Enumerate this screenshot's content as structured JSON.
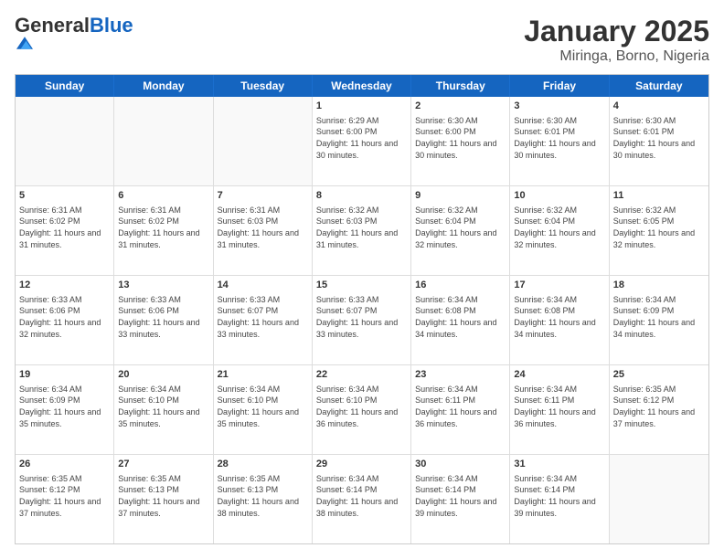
{
  "logo": {
    "general": "General",
    "blue": "Blue"
  },
  "title": "January 2025",
  "subtitle": "Miringa, Borno, Nigeria",
  "days": [
    "Sunday",
    "Monday",
    "Tuesday",
    "Wednesday",
    "Thursday",
    "Friday",
    "Saturday"
  ],
  "weeks": [
    [
      {
        "day": "",
        "info": ""
      },
      {
        "day": "",
        "info": ""
      },
      {
        "day": "",
        "info": ""
      },
      {
        "day": "1",
        "info": "Sunrise: 6:29 AM\nSunset: 6:00 PM\nDaylight: 11 hours and 30 minutes."
      },
      {
        "day": "2",
        "info": "Sunrise: 6:30 AM\nSunset: 6:00 PM\nDaylight: 11 hours and 30 minutes."
      },
      {
        "day": "3",
        "info": "Sunrise: 6:30 AM\nSunset: 6:01 PM\nDaylight: 11 hours and 30 minutes."
      },
      {
        "day": "4",
        "info": "Sunrise: 6:30 AM\nSunset: 6:01 PM\nDaylight: 11 hours and 30 minutes."
      }
    ],
    [
      {
        "day": "5",
        "info": "Sunrise: 6:31 AM\nSunset: 6:02 PM\nDaylight: 11 hours and 31 minutes."
      },
      {
        "day": "6",
        "info": "Sunrise: 6:31 AM\nSunset: 6:02 PM\nDaylight: 11 hours and 31 minutes."
      },
      {
        "day": "7",
        "info": "Sunrise: 6:31 AM\nSunset: 6:03 PM\nDaylight: 11 hours and 31 minutes."
      },
      {
        "day": "8",
        "info": "Sunrise: 6:32 AM\nSunset: 6:03 PM\nDaylight: 11 hours and 31 minutes."
      },
      {
        "day": "9",
        "info": "Sunrise: 6:32 AM\nSunset: 6:04 PM\nDaylight: 11 hours and 32 minutes."
      },
      {
        "day": "10",
        "info": "Sunrise: 6:32 AM\nSunset: 6:04 PM\nDaylight: 11 hours and 32 minutes."
      },
      {
        "day": "11",
        "info": "Sunrise: 6:32 AM\nSunset: 6:05 PM\nDaylight: 11 hours and 32 minutes."
      }
    ],
    [
      {
        "day": "12",
        "info": "Sunrise: 6:33 AM\nSunset: 6:06 PM\nDaylight: 11 hours and 32 minutes."
      },
      {
        "day": "13",
        "info": "Sunrise: 6:33 AM\nSunset: 6:06 PM\nDaylight: 11 hours and 33 minutes."
      },
      {
        "day": "14",
        "info": "Sunrise: 6:33 AM\nSunset: 6:07 PM\nDaylight: 11 hours and 33 minutes."
      },
      {
        "day": "15",
        "info": "Sunrise: 6:33 AM\nSunset: 6:07 PM\nDaylight: 11 hours and 33 minutes."
      },
      {
        "day": "16",
        "info": "Sunrise: 6:34 AM\nSunset: 6:08 PM\nDaylight: 11 hours and 34 minutes."
      },
      {
        "day": "17",
        "info": "Sunrise: 6:34 AM\nSunset: 6:08 PM\nDaylight: 11 hours and 34 minutes."
      },
      {
        "day": "18",
        "info": "Sunrise: 6:34 AM\nSunset: 6:09 PM\nDaylight: 11 hours and 34 minutes."
      }
    ],
    [
      {
        "day": "19",
        "info": "Sunrise: 6:34 AM\nSunset: 6:09 PM\nDaylight: 11 hours and 35 minutes."
      },
      {
        "day": "20",
        "info": "Sunrise: 6:34 AM\nSunset: 6:10 PM\nDaylight: 11 hours and 35 minutes."
      },
      {
        "day": "21",
        "info": "Sunrise: 6:34 AM\nSunset: 6:10 PM\nDaylight: 11 hours and 35 minutes."
      },
      {
        "day": "22",
        "info": "Sunrise: 6:34 AM\nSunset: 6:10 PM\nDaylight: 11 hours and 36 minutes."
      },
      {
        "day": "23",
        "info": "Sunrise: 6:34 AM\nSunset: 6:11 PM\nDaylight: 11 hours and 36 minutes."
      },
      {
        "day": "24",
        "info": "Sunrise: 6:34 AM\nSunset: 6:11 PM\nDaylight: 11 hours and 36 minutes."
      },
      {
        "day": "25",
        "info": "Sunrise: 6:35 AM\nSunset: 6:12 PM\nDaylight: 11 hours and 37 minutes."
      }
    ],
    [
      {
        "day": "26",
        "info": "Sunrise: 6:35 AM\nSunset: 6:12 PM\nDaylight: 11 hours and 37 minutes."
      },
      {
        "day": "27",
        "info": "Sunrise: 6:35 AM\nSunset: 6:13 PM\nDaylight: 11 hours and 37 minutes."
      },
      {
        "day": "28",
        "info": "Sunrise: 6:35 AM\nSunset: 6:13 PM\nDaylight: 11 hours and 38 minutes."
      },
      {
        "day": "29",
        "info": "Sunrise: 6:34 AM\nSunset: 6:14 PM\nDaylight: 11 hours and 38 minutes."
      },
      {
        "day": "30",
        "info": "Sunrise: 6:34 AM\nSunset: 6:14 PM\nDaylight: 11 hours and 39 minutes."
      },
      {
        "day": "31",
        "info": "Sunrise: 6:34 AM\nSunset: 6:14 PM\nDaylight: 11 hours and 39 minutes."
      },
      {
        "day": "",
        "info": ""
      }
    ]
  ]
}
